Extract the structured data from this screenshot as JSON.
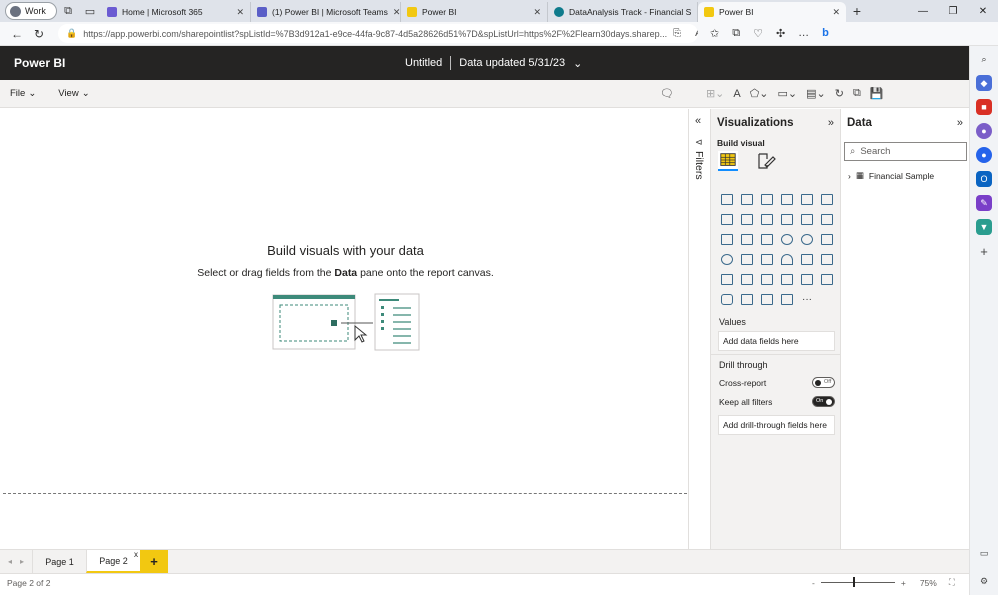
{
  "browser": {
    "profile_label": "Work",
    "tabs": [
      {
        "title": "Home | Microsoft 365",
        "color": "#6b5bd2"
      },
      {
        "title": "(1) Power BI | Microsoft Teams",
        "color": "#5b5fc7"
      },
      {
        "title": "Power BI",
        "color": "#f2c811"
      },
      {
        "title": "DataAnalysis Track - Financial S",
        "color": "#0f7b8c"
      },
      {
        "title": "Power BI",
        "color": "#f2c811"
      }
    ],
    "new_tab": "+",
    "url": "https://app.powerbi.com/sharepointlist?spListId=%7B3d912a1-e9ce-44fa-9c87-4d5a28626d51%7D&spListUrl=https%2F%2Flearn30days.sharep..."
  },
  "header": {
    "brand": "Power BI",
    "report_name": "Untitled",
    "data_updated": "Data updated 5/31/23"
  },
  "ribbon": {
    "file_label": "File",
    "view_label": "View"
  },
  "canvas": {
    "title": "Build visuals with your data",
    "subtitle_pre": "Select or drag fields from the ",
    "subtitle_bold": "Data",
    "subtitle_post": " pane onto the report canvas."
  },
  "filters": {
    "label": "Filters"
  },
  "visualizations": {
    "title": "Visualizations",
    "build_visual": "Build visual",
    "values_label": "Values",
    "values_well": "Add data fields here",
    "drill_through": "Drill through",
    "cross_report": "Cross-report",
    "cross_report_state": "Off",
    "keep_filters": "Keep all filters",
    "keep_filters_state": "On",
    "drill_well": "Add drill-through fields here",
    "more": "···"
  },
  "data_pane": {
    "title": "Data",
    "search_placeholder": "Search",
    "table_name": "Financial Sample"
  },
  "pages": {
    "tabs": [
      "Page 1",
      "Page 2"
    ],
    "active": "Page 2",
    "add": "+",
    "close": "x"
  },
  "status": {
    "page_info": "Page 2 of 2",
    "zoom_minus": "-",
    "zoom_plus": "+",
    "zoom": "75%"
  },
  "colors": {
    "pbi_header": "#252423",
    "pbi_yellow": "#f2c811",
    "accent_blue": "#118dff"
  }
}
